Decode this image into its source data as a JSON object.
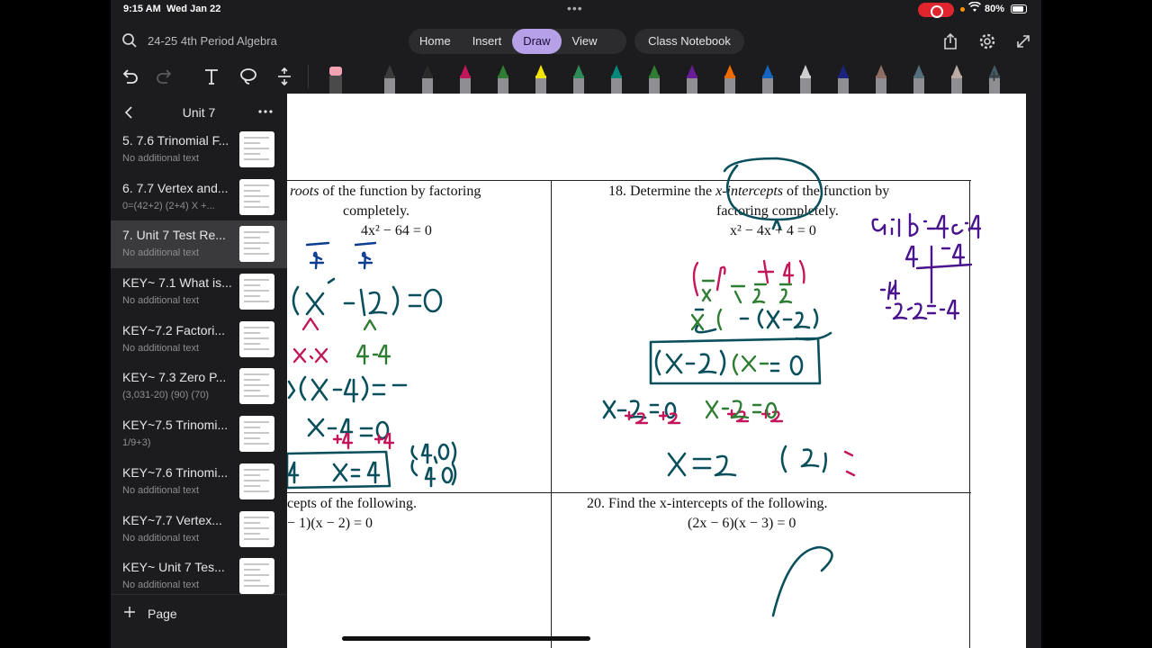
{
  "status": {
    "time": "9:15 AM",
    "date": "Wed Jan 22",
    "battery": "80%"
  },
  "nav": {
    "notebook_title": "24-25 4th Period Algebra",
    "tabs": [
      {
        "label": "Home"
      },
      {
        "label": "Insert"
      },
      {
        "label": "Draw",
        "active": true
      },
      {
        "label": "View"
      }
    ],
    "class_notebook": "Class Notebook"
  },
  "toolbar": {
    "tools": [
      "undo-icon",
      "redo-icon",
      "text-tool-icon",
      "lasso-icon",
      "insert-space-icon",
      "eraser-icon"
    ],
    "pen_colors": [
      "#3b3b3b",
      "#2a2a2a",
      "#c2185b",
      "#2e7d32",
      "#f2e600",
      "#2e8b57",
      "#00897b",
      "#2e7d32",
      "#6a1b9a",
      "#ef6c00",
      "#1565c0",
      "#d0d0d0",
      "#1a237e",
      "#8d6e63",
      "#546e7a",
      "#bcaaa4",
      "#455a64"
    ]
  },
  "sidebar": {
    "title": "Unit 7",
    "pages": [
      {
        "title": "5. 7.6 Trinomial F...",
        "subtitle": "No additional text"
      },
      {
        "title": "6. 7.7 Vertex and...",
        "subtitle": "0=(42+2) (2+4)  X +..."
      },
      {
        "title": "7. Unit 7 Test Re...",
        "subtitle": "No additional text",
        "selected": true
      },
      {
        "title": "KEY~ 7.1 What is...",
        "subtitle": "No additional text"
      },
      {
        "title": "KEY~7.2 Factori...",
        "subtitle": "No additional text"
      },
      {
        "title": "KEY~ 7.3 Zero P...",
        "subtitle": "(3,031-20) (90) (70)"
      },
      {
        "title": "KEY~7.5 Trinomi...",
        "subtitle": "1/9+3)"
      },
      {
        "title": "KEY~7.6 Trinomi...",
        "subtitle": "No additional text"
      },
      {
        "title": "KEY~7.7 Vertex...",
        "subtitle": "No additional text"
      },
      {
        "title": "KEY~ Unit 7 Tes...",
        "subtitle": "No additional text"
      }
    ],
    "add_page": "Page"
  },
  "worksheet": {
    "q17_line1_pre": "e ",
    "q17_line1_em": "roots",
    "q17_line1_post": " of the function by factoring",
    "q17_line2": "completely.",
    "q17_eq": "4x² − 64 = 0",
    "q18_line1_pre": "18.  Determine the ",
    "q18_line1_em": "x-intercepts",
    "q18_line1_post": " of the function by",
    "q18_line2": "factoring completely.",
    "q18_eq": "x² − 4x + 4 = 0",
    "q19_line1": "cepts of the following.",
    "q19_eq": "− 1)(x − 2) = 0",
    "q20_line1": "20.  Find the x-intercepts of the following.",
    "q20_eq": "(2x − 6)(x − 3) = 0"
  }
}
